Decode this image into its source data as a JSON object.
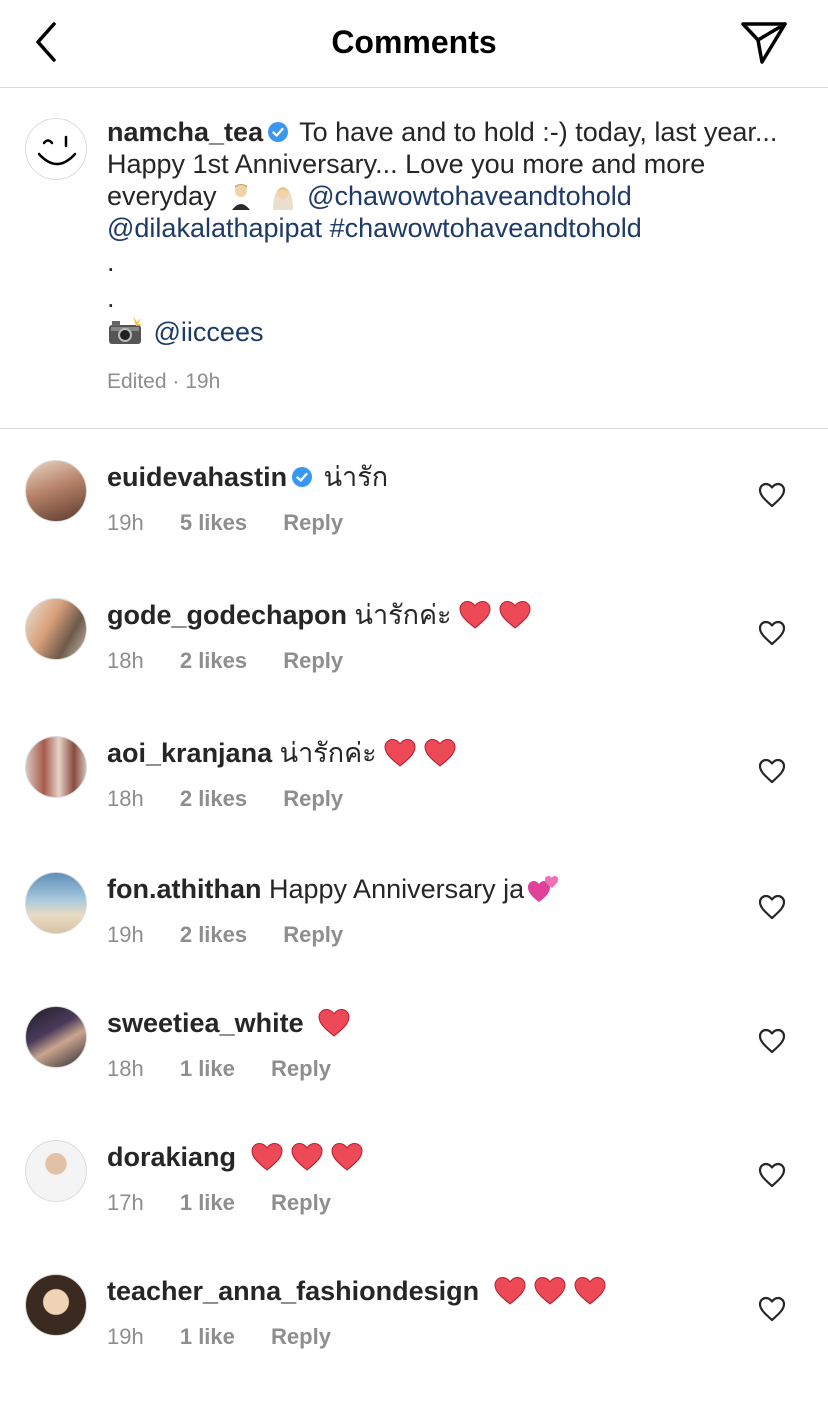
{
  "header": {
    "title": "Comments",
    "back_icon": "chevron-left-icon",
    "share_icon": "send-icon"
  },
  "caption": {
    "username": "namcha_tea",
    "text_part1": "To have and to hold :-) today, last year... Happy 1st Anniversary... Love you more and more everyday",
    "mention1": "@chawowtohaveandtohold",
    "mention2": "@dilakalathapipat",
    "hashtag": "#chawowtohaveandtohold",
    "dot1": ".",
    "dot2": ".",
    "credit_mention": "@iiccees",
    "meta": "Edited · 19h"
  },
  "colors": {
    "link": "#1e3a66",
    "verified": "#3897f0",
    "heart": "#ed4956",
    "secondary_text": "#8e8e8e",
    "divider": "#dbdbdb"
  },
  "comments": [
    {
      "username": "euidevahastin",
      "verified": true,
      "text": "น่ารัก",
      "hearts": 0,
      "emoji_after": "",
      "time": "19h",
      "likes": "5 likes",
      "reply": "Reply"
    },
    {
      "username": "gode_godechapon",
      "verified": false,
      "text": "น่ารักค่ะ",
      "hearts": 2,
      "emoji_after": "",
      "time": "18h",
      "likes": "2 likes",
      "reply": "Reply"
    },
    {
      "username": "aoi_kranjana",
      "verified": false,
      "text": "น่ารักค่ะ",
      "hearts": 2,
      "emoji_after": "",
      "time": "18h",
      "likes": "2 likes",
      "reply": "Reply"
    },
    {
      "username": "fon.athithan",
      "verified": false,
      "text": "Happy Anniversary ja",
      "hearts": 0,
      "emoji_after": "two-hearts",
      "time": "19h",
      "likes": "2 likes",
      "reply": "Reply"
    },
    {
      "username": "sweetiea_white",
      "verified": false,
      "text": "",
      "hearts": 1,
      "emoji_after": "",
      "time": "18h",
      "likes": "1 like",
      "reply": "Reply"
    },
    {
      "username": "dorakiang",
      "verified": false,
      "text": "",
      "hearts": 3,
      "emoji_after": "",
      "time": "17h",
      "likes": "1 like",
      "reply": "Reply"
    },
    {
      "username": "teacher_anna_fashiondesign",
      "verified": false,
      "text": "",
      "hearts": 3,
      "emoji_after": "",
      "time": "19h",
      "likes": "1 like",
      "reply": "Reply"
    }
  ]
}
